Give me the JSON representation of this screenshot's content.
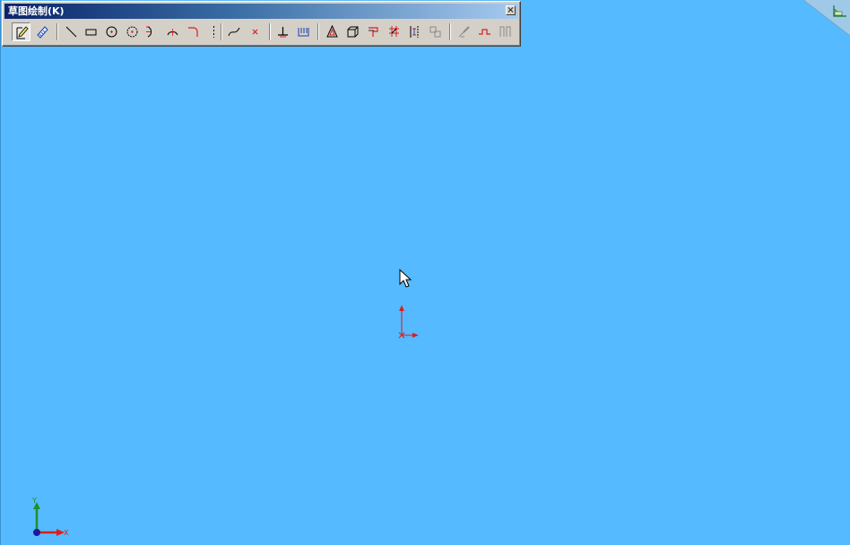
{
  "toolbar": {
    "title": "草图绘制(K)",
    "close_label": "×",
    "tools": [
      {
        "name": "sketch-icon",
        "active": true
      },
      {
        "name": "smart-dimension-icon"
      },
      {
        "name": "line-icon"
      },
      {
        "name": "rectangle-icon"
      },
      {
        "name": "circle-icon"
      },
      {
        "name": "perimeter-circle-icon"
      },
      {
        "name": "centerpoint-arc-icon"
      },
      {
        "name": "three-point-arc-icon"
      },
      {
        "name": "fillet-icon"
      },
      {
        "name": "centerline-icon"
      },
      {
        "name": "spline-icon"
      },
      {
        "name": "point-icon"
      },
      {
        "name": "trim-icon"
      },
      {
        "name": "extend-icon"
      },
      {
        "name": "offset-entities-icon"
      },
      {
        "name": "mirror-icon"
      },
      {
        "name": "convert-entities-icon"
      },
      {
        "name": "move-entities-icon"
      },
      {
        "name": "linear-pattern-icon"
      },
      {
        "name": "add-relation-icon"
      },
      {
        "name": "modify-sketch-icon"
      },
      {
        "name": "split-entities-icon"
      },
      {
        "name": "sketch-slot-icon"
      },
      {
        "name": "rapid-sketch-icon"
      }
    ]
  },
  "triad": {
    "x_label": "X",
    "y_label": "Y"
  },
  "colors": {
    "background": "#55baff",
    "sketch_red": "#d81e1e",
    "axis_green": "#1f8f2a",
    "axis_blue": "#1a1a9e"
  }
}
